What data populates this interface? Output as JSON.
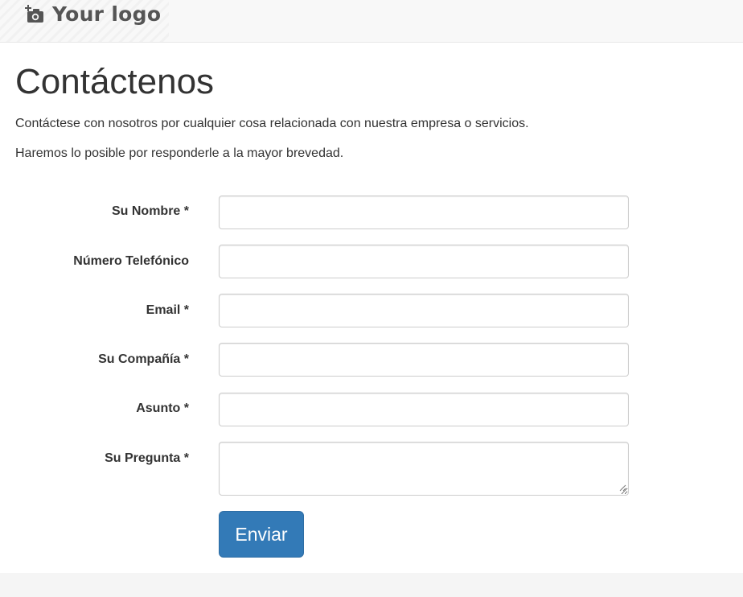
{
  "header": {
    "logo_text": "Your logo",
    "logo_icon": "camera-plus-icon"
  },
  "main": {
    "title": "Contáctenos",
    "intro_lines": [
      "Contáctese con nosotros por cualquier cosa relacionada con nuestra empresa o servicios.",
      "Haremos lo posible por responderle a la mayor brevedad."
    ]
  },
  "form": {
    "fields": [
      {
        "label": "Su Nombre *",
        "value": ""
      },
      {
        "label": "Número Telefónico",
        "value": ""
      },
      {
        "label": "Email *",
        "value": ""
      },
      {
        "label": "Su Compañía *",
        "value": ""
      },
      {
        "label": "Asunto *",
        "value": ""
      },
      {
        "label": "Su Pregunta *",
        "value": ""
      }
    ],
    "submit_label": "Enviar"
  },
  "colors": {
    "primary": "#337ab7",
    "header_bg": "#f8f8f8",
    "text": "#333333"
  }
}
